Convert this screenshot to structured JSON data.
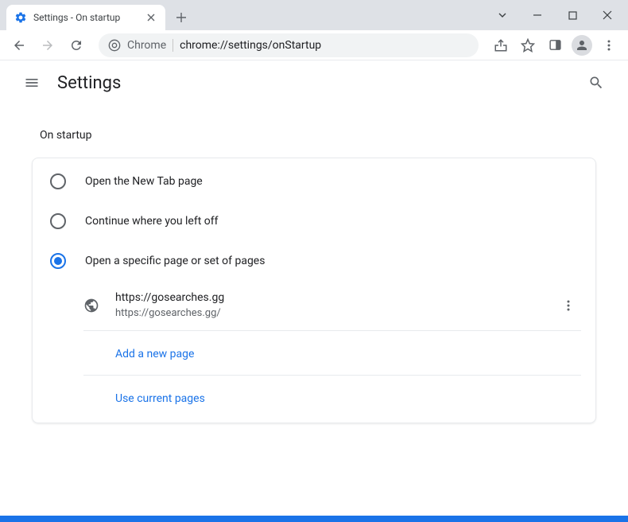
{
  "window": {
    "tab_title": "Settings - On startup"
  },
  "toolbar": {
    "chrome_label": "Chrome",
    "url": "chrome://settings/onStartup"
  },
  "header": {
    "title": "Settings"
  },
  "section": {
    "title": "On startup",
    "options": [
      {
        "label": "Open the New Tab page",
        "selected": false
      },
      {
        "label": "Continue where you left off",
        "selected": false
      },
      {
        "label": "Open a specific page or set of pages",
        "selected": true
      }
    ],
    "pages": [
      {
        "name": "https://gosearches.gg",
        "url": "https://gosearches.gg/"
      }
    ],
    "add_page_label": "Add a new page",
    "use_current_label": "Use current pages"
  }
}
